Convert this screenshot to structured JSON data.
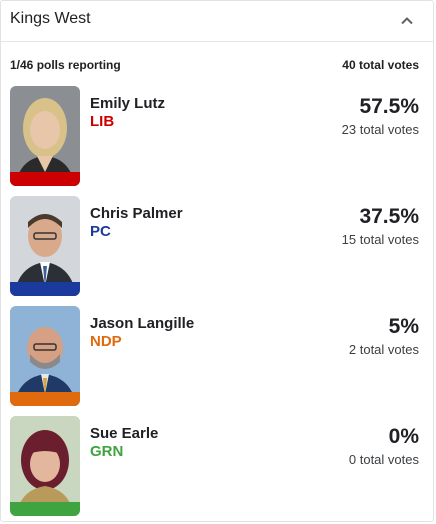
{
  "header": {
    "title": "Kings West",
    "collapse_icon": "chevron-up-icon"
  },
  "summary": {
    "polls": "1/46 polls reporting",
    "total_votes": "40 total votes"
  },
  "candidates": [
    {
      "name": "Emily Lutz",
      "party": "LIB",
      "party_color": "#cc0000",
      "percent": "57.5%",
      "votes": "23 total votes",
      "share": 0.575
    },
    {
      "name": "Chris Palmer",
      "party": "PC",
      "party_color": "#1a3a9e",
      "percent": "37.5%",
      "votes": "15 total votes",
      "share": 0.375
    },
    {
      "name": "Jason Langille",
      "party": "NDP",
      "party_color": "#e06b0f",
      "percent": "5%",
      "votes": "2 total votes",
      "share": 0.05
    },
    {
      "name": "Sue Earle",
      "party": "GRN",
      "party_color": "#3fa33f",
      "percent": "0%",
      "votes": "0 total votes",
      "share": 0.0
    }
  ]
}
